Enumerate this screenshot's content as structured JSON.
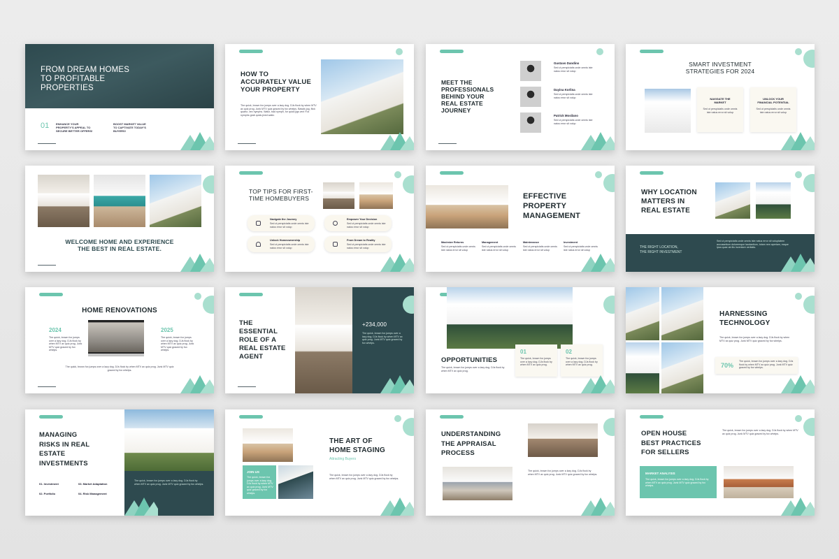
{
  "colors": {
    "accent": "#6cc5ae",
    "dark": "#2e4a4f",
    "text": "#1f2a2e"
  },
  "s1": {
    "title": [
      "FROM DREAM HOMES",
      "TO PROFITABLE",
      "PROPERTIES"
    ],
    "num": "01",
    "c1": [
      "ENHANCE YOUR",
      "PROPERTY'S APPEAL TO",
      "SECURE BETTER OFFERS!"
    ],
    "c2": [
      "BOOST MARKET VALUE",
      "TO CAPTIVATE TODAY'S",
      "BUYERS!"
    ]
  },
  "s2": {
    "title": [
      "HOW TO",
      "ACCURATELY VALUE",
      "YOUR PROPERTY"
    ],
    "body": "The quick, brown fox jumps over a lazy dog. DJs flock by when MTV ax quiz prog. Junk MTV quiz graced by fox whelps. Bawds jog, flick quartz, vex nymphs. Waltz, bad nymph, for quick jigs vex! Fox nymphs grab quick-jived waltz."
  },
  "s3": {
    "title": [
      "MEET THE",
      "PROFESSIONALS",
      "BEHIND YOUR",
      "REAL ESTATE",
      "JOURNEY"
    ],
    "people": [
      {
        "name": "Gustavo Dandino",
        "desc": "Sed ut perspiciatis unde omnis iste natus error sit volup"
      },
      {
        "name": "Dayina Korlina",
        "desc": "Sed ut perspiciatis unde omnis iste natus error sit volup"
      },
      {
        "name": "Patrick Mosilano",
        "desc": "Sed ut perspiciatis unde omnis iste natus error sit volup"
      }
    ]
  },
  "s4": {
    "title": [
      "SMART INVESTMENT",
      "STRATEGIES FOR 2024"
    ],
    "c1": [
      "NAVIGATE THE",
      "MARKET"
    ],
    "c2": [
      "UNLOCK YOUR",
      "FINANCIAL POTENTIAL"
    ],
    "desc": "Sed ut perspiciatis unde omnis iste natus error sit volup"
  },
  "s5": {
    "title": [
      "WELCOME HOME AND EXPERIENCE",
      "THE BEST IN REAL ESTATE."
    ]
  },
  "s6": {
    "title": [
      "TOP TIPS FOR FIRST-",
      "TIME HOMEBUYERS"
    ],
    "tips": [
      "Navigate the Journey",
      "Empower Your Decision",
      "Unlock Homeownership",
      "From Dream to Reality"
    ],
    "desc": "Sed ut perspiciatis unde omnis iste natus error sit volup"
  },
  "s7": {
    "title": [
      "EFFECTIVE",
      "PROPERTY",
      "MANAGEMENT"
    ],
    "cols": [
      "Maximize Returns",
      "Management",
      "Maintenance",
      "Investment"
    ],
    "desc": "Sed ut perspiciatis unde omnis iste natus error sit volup"
  },
  "s8": {
    "title": [
      "WHY LOCATION",
      "MATTERS IN",
      "REAL ESTATE"
    ],
    "sub": [
      "THE RIGHT LOCATION,",
      "THE RIGHT INVESTMENT"
    ]
  },
  "s9": {
    "title": "HOME RENOVATIONS",
    "y1": "2024",
    "y2": "2025",
    "body": "The quick, brown fox jumps over a lazy dog. DJs flock by when MTV ax quiz prog. Junk MTV quiz graced by fox whelps."
  },
  "s10": {
    "title": [
      "THE",
      "ESSENTIAL",
      "ROLE OF A",
      "REAL ESTATE",
      "AGENT"
    ],
    "stat": "+234,000",
    "body": "The quick, brown fox jumps over a lazy dog. DJs flock by when MTV ax quiz prog. Junk MTV quiz graced by fox whelps."
  },
  "s11": {
    "title": "OPPORTUNITIES",
    "n1": "01",
    "n2": "02",
    "body": "The quick, brown fox jumps over a lazy dog. DJs flock by when MTV ax quiz prog."
  },
  "s12": {
    "title": [
      "HARNESSING",
      "TECHNOLOGY"
    ],
    "pct": "70%",
    "body": "The quick, brown fox jumps over a lazy dog. DJs flock by when MTV ax quiz prog. Junk MTV quiz graced by fox whelps."
  },
  "s13": {
    "title": [
      "MANAGING",
      "RISKS IN REAL",
      "ESTATE",
      "INVESTMENTS"
    ],
    "items": [
      "01. Investment",
      "03. Market Adaptation",
      "02. Portfolio",
      "04. Risk Management"
    ],
    "body": "The quick, brown fox jumps over a lazy dog. DJs flock by when MTV ax quiz prog. Junk MTV quiz graced by fox whelps."
  },
  "s14": {
    "title": [
      "THE ART OF",
      "HOME STAGING"
    ],
    "sub": "Attracting Buyers",
    "join": "JOIN US",
    "body": "The quick, brown fox jumps over a lazy dog. DJs flock by when MTV ax quiz prog. Junk MTV quiz graced by fox whelps."
  },
  "s15": {
    "title": [
      "UNDERSTANDING",
      "THE APPRAISAL",
      "PROCESS"
    ],
    "body": "The quick, brown fox jumps over a lazy dog. DJs flock by when MTV ax quiz prog. Junk MTV quiz graced by fox whelps."
  },
  "s16": {
    "title": [
      "OPEN HOUSE",
      "BEST PRACTICES",
      "FOR SELLERS"
    ],
    "box": "MARKET ANALYSIS",
    "body": "The quick, brown fox jumps over a lazy dog. DJs flock by when MTV ax quiz prog. Junk MTV quiz graced by fox whelps."
  }
}
